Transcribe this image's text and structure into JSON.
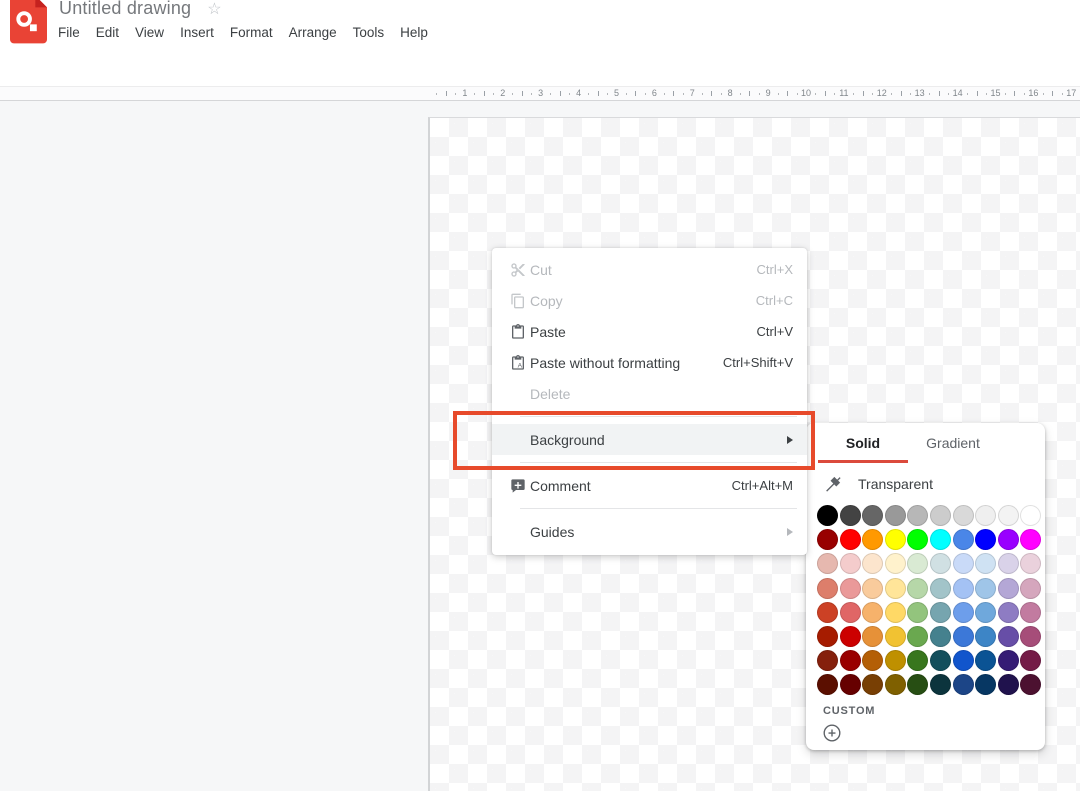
{
  "app": {
    "title": "Untitled drawing",
    "logo_icon": "drawings-logo-icon",
    "star_icon": "star-outline-icon"
  },
  "menu_bar": {
    "items": [
      "File",
      "Edit",
      "View",
      "Insert",
      "Format",
      "Arrange",
      "Tools",
      "Help"
    ]
  },
  "toolbar": {
    "buttons": [
      {
        "name": "undo-button",
        "icon": "undo-icon"
      },
      {
        "name": "redo-button",
        "icon": "redo-icon"
      },
      {
        "name": "print-button",
        "icon": "print-icon"
      },
      {
        "name": "paint-format-button",
        "icon": "paint-roller-icon",
        "disabled": true
      },
      {
        "separator": true
      },
      {
        "name": "zoom-button",
        "icon": "zoom-icon",
        "has_dropdown": true
      },
      {
        "separator": true
      },
      {
        "name": "select-button",
        "icon": "cursor-icon",
        "active": true
      },
      {
        "name": "line-button",
        "icon": "line-icon",
        "has_dropdown": true
      },
      {
        "name": "shape-button",
        "icon": "shape-icon"
      },
      {
        "name": "text-box-button",
        "icon": "text-box-icon"
      },
      {
        "name": "image-button",
        "icon": "image-icon",
        "has_dropdown": true
      },
      {
        "separator": true
      },
      {
        "name": "insert-comment-button",
        "icon": "comment-plus-icon"
      }
    ]
  },
  "ruler": {
    "numbers": [
      1,
      2,
      3,
      4,
      5,
      6,
      7,
      8,
      9,
      10,
      11,
      12,
      13,
      14,
      15,
      16,
      17
    ]
  },
  "context_menu": {
    "items": [
      {
        "label": "Cut",
        "shortcut": "Ctrl+X",
        "icon": "scissors-icon",
        "disabled": true
      },
      {
        "label": "Copy",
        "shortcut": "Ctrl+C",
        "icon": "copy-icon",
        "disabled": true
      },
      {
        "label": "Paste",
        "shortcut": "Ctrl+V",
        "icon": "clipboard-icon"
      },
      {
        "label": "Paste without formatting",
        "shortcut": "Ctrl+Shift+V",
        "icon": "clipboard-text-icon"
      },
      {
        "label": "Delete",
        "disabled": true
      },
      {
        "type": "separator"
      },
      {
        "label": "Background",
        "submenu": true,
        "highlighted": true
      },
      {
        "type": "separator"
      },
      {
        "label": "Comment",
        "shortcut": "Ctrl+Alt+M",
        "icon": "comment-plus-icon"
      },
      {
        "type": "separator"
      },
      {
        "label": "Guides",
        "submenu": true,
        "submenu_disabled": true
      }
    ]
  },
  "color_picker": {
    "tabs": [
      {
        "label": "Solid",
        "active": true
      },
      {
        "label": "Gradient",
        "active": false
      }
    ],
    "transparent_label": "Transparent",
    "transparent_icon": "no-fill-icon",
    "custom_label": "CUSTOM",
    "add_custom_icon": "plus-circle-icon",
    "rows": [
      [
        "#000000",
        "#434343",
        "#666666",
        "#999999",
        "#b7b7b7",
        "#cccccc",
        "#d9d9d9",
        "#efefef",
        "#f3f3f3",
        "#ffffff"
      ],
      [
        "#980000",
        "#ff0000",
        "#ff9900",
        "#ffff00",
        "#00ff00",
        "#00ffff",
        "#4a86e8",
        "#0000ff",
        "#9900ff",
        "#ff00ff"
      ],
      [
        "#e6b8af",
        "#f4cccc",
        "#fce5cd",
        "#fff2cc",
        "#d9ead3",
        "#d0e0e3",
        "#c9daf8",
        "#cfe2f3",
        "#d9d2e9",
        "#ead1dc"
      ],
      [
        "#dd7e6b",
        "#ea9999",
        "#f9cb9c",
        "#ffe599",
        "#b6d7a8",
        "#a2c4c9",
        "#a4c2f4",
        "#9fc5e8",
        "#b4a7d6",
        "#d5a6bd"
      ],
      [
        "#cc4125",
        "#e06666",
        "#f6b26b",
        "#ffd966",
        "#93c47d",
        "#76a5af",
        "#6d9eeb",
        "#6fa8dc",
        "#8e7cc3",
        "#c27ba0"
      ],
      [
        "#a61c00",
        "#cc0000",
        "#e69138",
        "#f1c232",
        "#6aa84f",
        "#45818e",
        "#3c78d8",
        "#3d85c6",
        "#674ea7",
        "#a64d79"
      ],
      [
        "#85200c",
        "#990000",
        "#b45f06",
        "#bf9000",
        "#38761d",
        "#134f5c",
        "#1155cc",
        "#0b5394",
        "#351c75",
        "#741b47"
      ],
      [
        "#5b0f00",
        "#660000",
        "#783f04",
        "#7f6000",
        "#274e13",
        "#0c343d",
        "#1c4587",
        "#073763",
        "#20124d",
        "#4c1130"
      ]
    ]
  },
  "colors": {
    "annotation_highlight": "#e74a2b",
    "tab_underline": "#db4a3c",
    "active_tool_background": "#e8f0fe",
    "cursor_blue": "#1a73e8",
    "logo_red": "#e94335"
  }
}
